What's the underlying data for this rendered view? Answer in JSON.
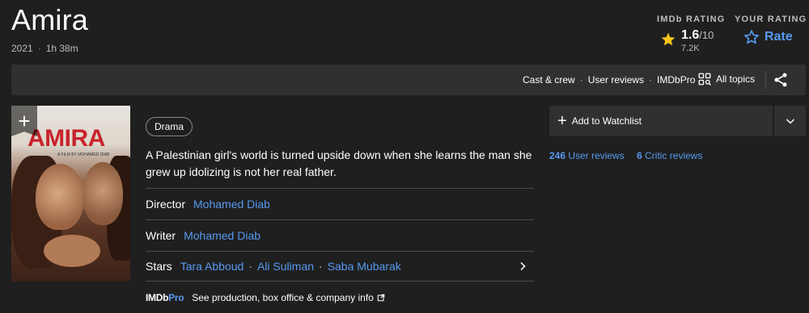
{
  "title": "Amira",
  "meta": {
    "year": "2021",
    "sep": "·",
    "runtime": "1h 38m"
  },
  "ratings": {
    "imdb_label": "IMDb RATING",
    "your_label": "YOUR RATING",
    "score": "1.6",
    "out_of": "/10",
    "votes": "7.2K",
    "rate_label": "Rate",
    "accent": "#f5c518",
    "link_color": "#5799ef"
  },
  "subnav": {
    "links": [
      "Cast & crew",
      "User reviews",
      "IMDbPro"
    ],
    "sep": "·",
    "all_topics": "All topics"
  },
  "poster": {
    "title": "AMIRA",
    "subtitle": "A FILM BY MOHAMED DIAB"
  },
  "genre": "Drama",
  "plot": "A Palestinian girl's world is turned upside down when she learns the man she grew up idolizing is not her real father.",
  "credits": {
    "director_label": "Director",
    "director": "Mohamed Diab",
    "writer_label": "Writer",
    "writer": "Mohamed Diab",
    "stars_label": "Stars",
    "stars": [
      "Tara Abboud",
      "Ali Suliman",
      "Saba Mubarak"
    ],
    "sep": "·"
  },
  "imdbpro": {
    "logo_a": "IMDb",
    "logo_b": "Pro",
    "text": "See production, box office & company info"
  },
  "watchlist": {
    "label": "Add to Watchlist"
  },
  "reviews": {
    "user_count": "246",
    "user_label": "User reviews",
    "critic_count": "6",
    "critic_label": "Critic reviews"
  }
}
